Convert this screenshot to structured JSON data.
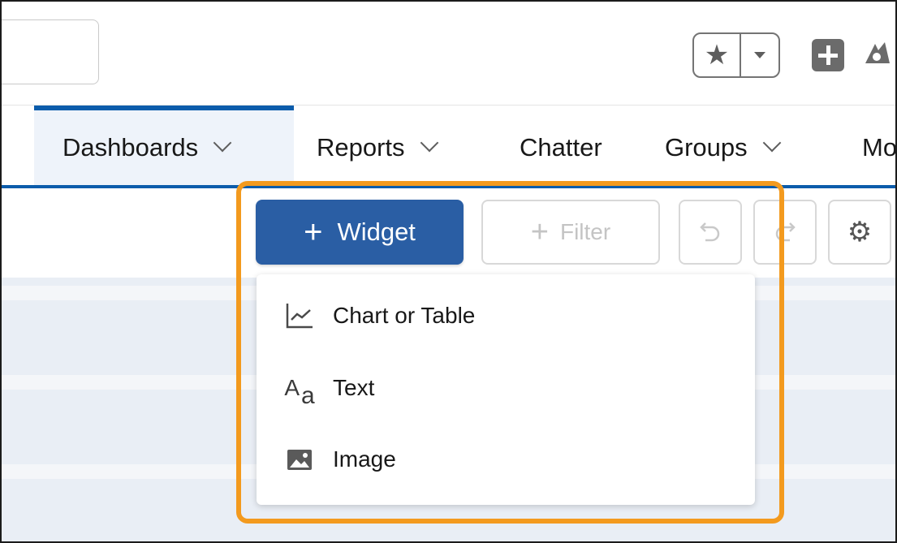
{
  "nav": {
    "items": [
      {
        "label": "Dashboards",
        "has_dropdown": true,
        "active": true
      },
      {
        "label": "Reports",
        "has_dropdown": true
      },
      {
        "label": "Chatter",
        "has_dropdown": false
      },
      {
        "label": "Groups",
        "has_dropdown": true
      },
      {
        "label": "Mo",
        "has_dropdown": false
      }
    ]
  },
  "toolbar": {
    "widget_label": "Widget",
    "filter_label": "Filter"
  },
  "widget_menu": {
    "items": [
      {
        "label": "Chart or Table",
        "icon": "line-chart-icon"
      },
      {
        "label": "Text",
        "icon": "text-format-icon"
      },
      {
        "label": "Image",
        "icon": "image-icon"
      }
    ]
  },
  "colors": {
    "brand_blue": "#0b5cab",
    "widget_button": "#2a5ea4",
    "highlight": "#f39a1e"
  }
}
